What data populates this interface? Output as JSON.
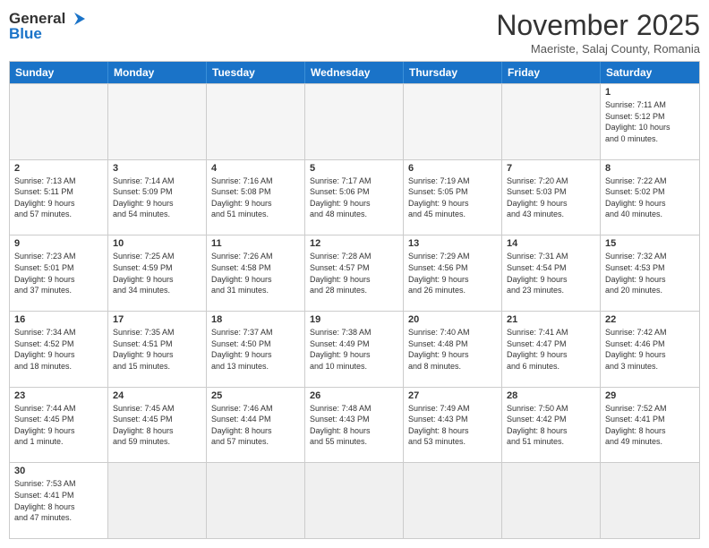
{
  "logo": {
    "text_general": "General",
    "text_blue": "Blue"
  },
  "title": {
    "month_year": "November 2025",
    "location": "Maeriste, Salaj County, Romania"
  },
  "weekdays": [
    "Sunday",
    "Monday",
    "Tuesday",
    "Wednesday",
    "Thursday",
    "Friday",
    "Saturday"
  ],
  "rows": [
    [
      {
        "day": "",
        "info": ""
      },
      {
        "day": "",
        "info": ""
      },
      {
        "day": "",
        "info": ""
      },
      {
        "day": "",
        "info": ""
      },
      {
        "day": "",
        "info": ""
      },
      {
        "day": "",
        "info": ""
      },
      {
        "day": "1",
        "info": "Sunrise: 7:11 AM\nSunset: 5:12 PM\nDaylight: 10 hours\nand 0 minutes."
      }
    ],
    [
      {
        "day": "2",
        "info": "Sunrise: 7:13 AM\nSunset: 5:11 PM\nDaylight: 9 hours\nand 57 minutes."
      },
      {
        "day": "3",
        "info": "Sunrise: 7:14 AM\nSunset: 5:09 PM\nDaylight: 9 hours\nand 54 minutes."
      },
      {
        "day": "4",
        "info": "Sunrise: 7:16 AM\nSunset: 5:08 PM\nDaylight: 9 hours\nand 51 minutes."
      },
      {
        "day": "5",
        "info": "Sunrise: 7:17 AM\nSunset: 5:06 PM\nDaylight: 9 hours\nand 48 minutes."
      },
      {
        "day": "6",
        "info": "Sunrise: 7:19 AM\nSunset: 5:05 PM\nDaylight: 9 hours\nand 45 minutes."
      },
      {
        "day": "7",
        "info": "Sunrise: 7:20 AM\nSunset: 5:03 PM\nDaylight: 9 hours\nand 43 minutes."
      },
      {
        "day": "8",
        "info": "Sunrise: 7:22 AM\nSunset: 5:02 PM\nDaylight: 9 hours\nand 40 minutes."
      }
    ],
    [
      {
        "day": "9",
        "info": "Sunrise: 7:23 AM\nSunset: 5:01 PM\nDaylight: 9 hours\nand 37 minutes."
      },
      {
        "day": "10",
        "info": "Sunrise: 7:25 AM\nSunset: 4:59 PM\nDaylight: 9 hours\nand 34 minutes."
      },
      {
        "day": "11",
        "info": "Sunrise: 7:26 AM\nSunset: 4:58 PM\nDaylight: 9 hours\nand 31 minutes."
      },
      {
        "day": "12",
        "info": "Sunrise: 7:28 AM\nSunset: 4:57 PM\nDaylight: 9 hours\nand 28 minutes."
      },
      {
        "day": "13",
        "info": "Sunrise: 7:29 AM\nSunset: 4:56 PM\nDaylight: 9 hours\nand 26 minutes."
      },
      {
        "day": "14",
        "info": "Sunrise: 7:31 AM\nSunset: 4:54 PM\nDaylight: 9 hours\nand 23 minutes."
      },
      {
        "day": "15",
        "info": "Sunrise: 7:32 AM\nSunset: 4:53 PM\nDaylight: 9 hours\nand 20 minutes."
      }
    ],
    [
      {
        "day": "16",
        "info": "Sunrise: 7:34 AM\nSunset: 4:52 PM\nDaylight: 9 hours\nand 18 minutes."
      },
      {
        "day": "17",
        "info": "Sunrise: 7:35 AM\nSunset: 4:51 PM\nDaylight: 9 hours\nand 15 minutes."
      },
      {
        "day": "18",
        "info": "Sunrise: 7:37 AM\nSunset: 4:50 PM\nDaylight: 9 hours\nand 13 minutes."
      },
      {
        "day": "19",
        "info": "Sunrise: 7:38 AM\nSunset: 4:49 PM\nDaylight: 9 hours\nand 10 minutes."
      },
      {
        "day": "20",
        "info": "Sunrise: 7:40 AM\nSunset: 4:48 PM\nDaylight: 9 hours\nand 8 minutes."
      },
      {
        "day": "21",
        "info": "Sunrise: 7:41 AM\nSunset: 4:47 PM\nDaylight: 9 hours\nand 6 minutes."
      },
      {
        "day": "22",
        "info": "Sunrise: 7:42 AM\nSunset: 4:46 PM\nDaylight: 9 hours\nand 3 minutes."
      }
    ],
    [
      {
        "day": "23",
        "info": "Sunrise: 7:44 AM\nSunset: 4:45 PM\nDaylight: 9 hours\nand 1 minute."
      },
      {
        "day": "24",
        "info": "Sunrise: 7:45 AM\nSunset: 4:45 PM\nDaylight: 8 hours\nand 59 minutes."
      },
      {
        "day": "25",
        "info": "Sunrise: 7:46 AM\nSunset: 4:44 PM\nDaylight: 8 hours\nand 57 minutes."
      },
      {
        "day": "26",
        "info": "Sunrise: 7:48 AM\nSunset: 4:43 PM\nDaylight: 8 hours\nand 55 minutes."
      },
      {
        "day": "27",
        "info": "Sunrise: 7:49 AM\nSunset: 4:43 PM\nDaylight: 8 hours\nand 53 minutes."
      },
      {
        "day": "28",
        "info": "Sunrise: 7:50 AM\nSunset: 4:42 PM\nDaylight: 8 hours\nand 51 minutes."
      },
      {
        "day": "29",
        "info": "Sunrise: 7:52 AM\nSunset: 4:41 PM\nDaylight: 8 hours\nand 49 minutes."
      }
    ],
    [
      {
        "day": "30",
        "info": "Sunrise: 7:53 AM\nSunset: 4:41 PM\nDaylight: 8 hours\nand 47 minutes."
      },
      {
        "day": "",
        "info": ""
      },
      {
        "day": "",
        "info": ""
      },
      {
        "day": "",
        "info": ""
      },
      {
        "day": "",
        "info": ""
      },
      {
        "day": "",
        "info": ""
      },
      {
        "day": "",
        "info": ""
      }
    ]
  ]
}
